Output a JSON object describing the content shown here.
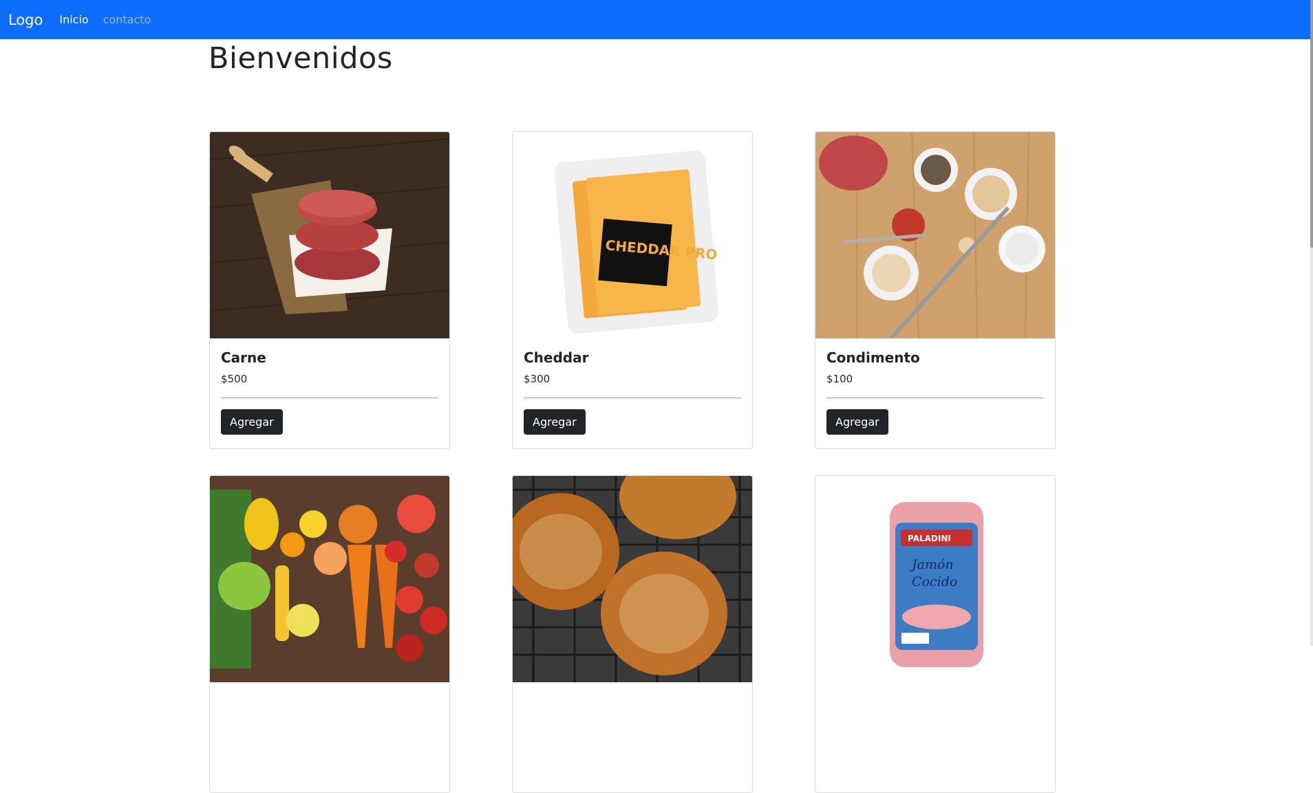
{
  "navbar": {
    "brand": "Logo",
    "links": [
      {
        "label": "Inicio",
        "active": true
      },
      {
        "label": "contacto",
        "active": false
      }
    ],
    "color": "#0d6efd"
  },
  "page": {
    "title": "Bienvenidos"
  },
  "products": [
    {
      "name": "Carne",
      "price": "$500",
      "button": "Agregar",
      "image": "burger-patties-photo"
    },
    {
      "name": "Cheddar",
      "price": "$300",
      "button": "Agregar",
      "image": "cheddar-package-photo",
      "image_text": "CHEDDAR PRO"
    },
    {
      "name": "Condimento",
      "price": "$100",
      "button": "Agregar",
      "image": "spices-photo"
    },
    {
      "name": "",
      "price": "",
      "button": "",
      "image": "vegetables-photo"
    },
    {
      "name": "",
      "price": "",
      "button": "",
      "image": "sesame-buns-photo"
    },
    {
      "name": "",
      "price": "",
      "button": "",
      "image": "ham-package-photo",
      "image_text": "PALADINI Jamón Cocido"
    }
  ]
}
